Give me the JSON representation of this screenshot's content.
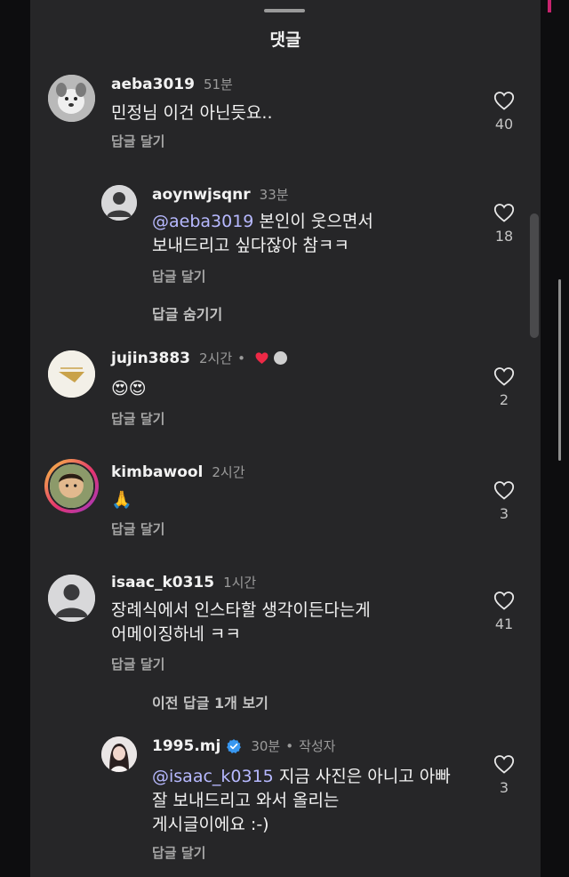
{
  "header": {
    "title": "댓글"
  },
  "comments": [
    {
      "username": "aeba3019",
      "time": "51분",
      "text": "민정님 이건 아닌듯요..",
      "reply_label": "답글 달기",
      "likes": "40"
    },
    {
      "username": "aoynwjsqnr",
      "time": "33분",
      "mention": "@aeba3019",
      "text_line1": " 본인이 웃으면서",
      "text_line2": "보내드리고 싶다잖아 참ㅋㅋ",
      "reply_label": "답글 달기",
      "likes": "18"
    },
    {
      "username": "jujin3883",
      "time": "2시간",
      "text": "😍😍",
      "reply_label": "답글 달기",
      "likes": "2"
    },
    {
      "username": "kimbawool",
      "time": "2시간",
      "text": "🙏",
      "reply_label": "답글 달기",
      "likes": "3"
    },
    {
      "username": "isaac_k0315",
      "time": "1시간",
      "text_line1": "장례식에서 인스타할 생각이든다는게",
      "text_line2": "어메이징하네 ㅋㅋ",
      "reply_label": "답글 달기",
      "likes": "41"
    },
    {
      "username": "1995.mj",
      "time": "30분",
      "author_tag": "작성자",
      "mention": "@isaac_k0315",
      "text_line1": " 지금 사진은 아니고 아빠",
      "text_line2": "잘 보내드리고 와서 올리는",
      "text_line3": "게시글이에요 :-)",
      "reply_label": "답글 달기",
      "likes": "3"
    }
  ],
  "links": {
    "hide_replies": "답글 숨기기",
    "view_previous": "이전 답글 1개 보기"
  },
  "icons": {
    "like": "heart-outline-icon",
    "verified": "verified-badge-icon",
    "liked_by_author": "red-heart-icon"
  },
  "colors": {
    "background": "#262628",
    "mention": "#b7b9ff",
    "verified": "#3897f0",
    "liked_heart": "#ed2946"
  }
}
